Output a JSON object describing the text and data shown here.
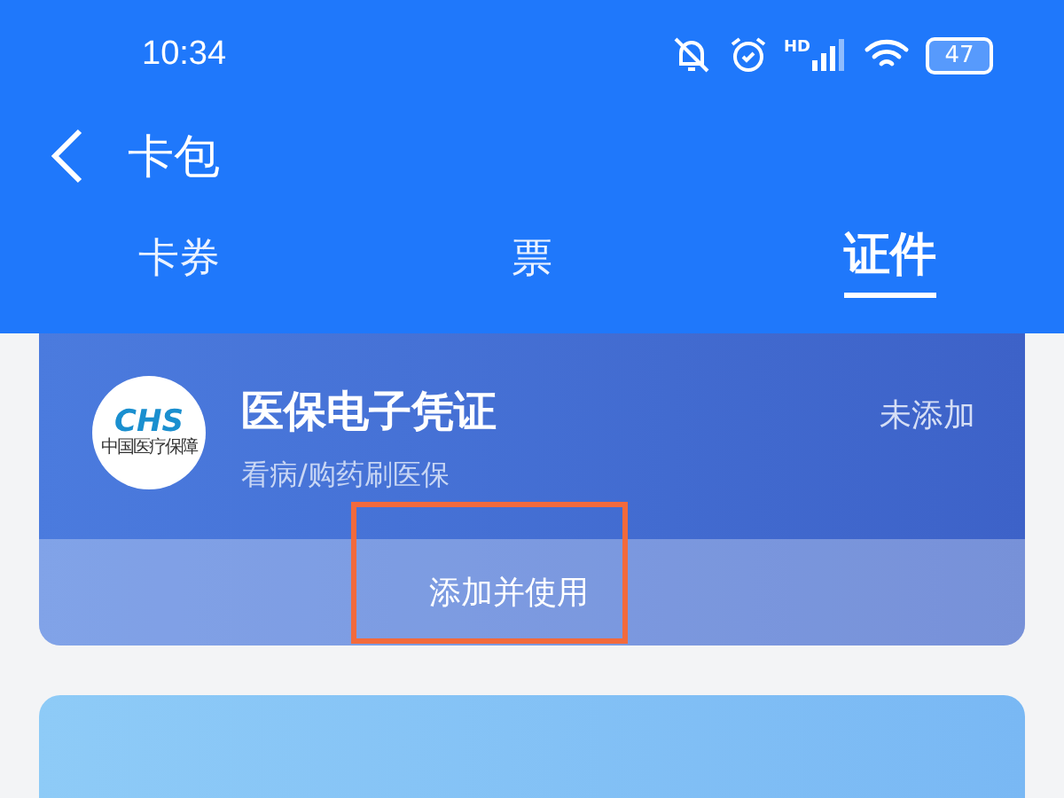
{
  "status_bar": {
    "time": "10:34",
    "signal_label": "HD",
    "battery": "47"
  },
  "nav": {
    "title": "卡包"
  },
  "tabs": [
    {
      "label": "卡券",
      "selected": false
    },
    {
      "label": "票",
      "selected": false
    },
    {
      "label": "证件",
      "selected": true
    }
  ],
  "cards": [
    {
      "logo_text": "CHS",
      "logo_caption": "中国医疗保障",
      "title": "医保电子凭证",
      "subtitle": "看病/购药刷医保",
      "status": "未添加",
      "action": "添加并使用",
      "highlighted": true
    }
  ],
  "next_card": {
    "visible": true
  }
}
